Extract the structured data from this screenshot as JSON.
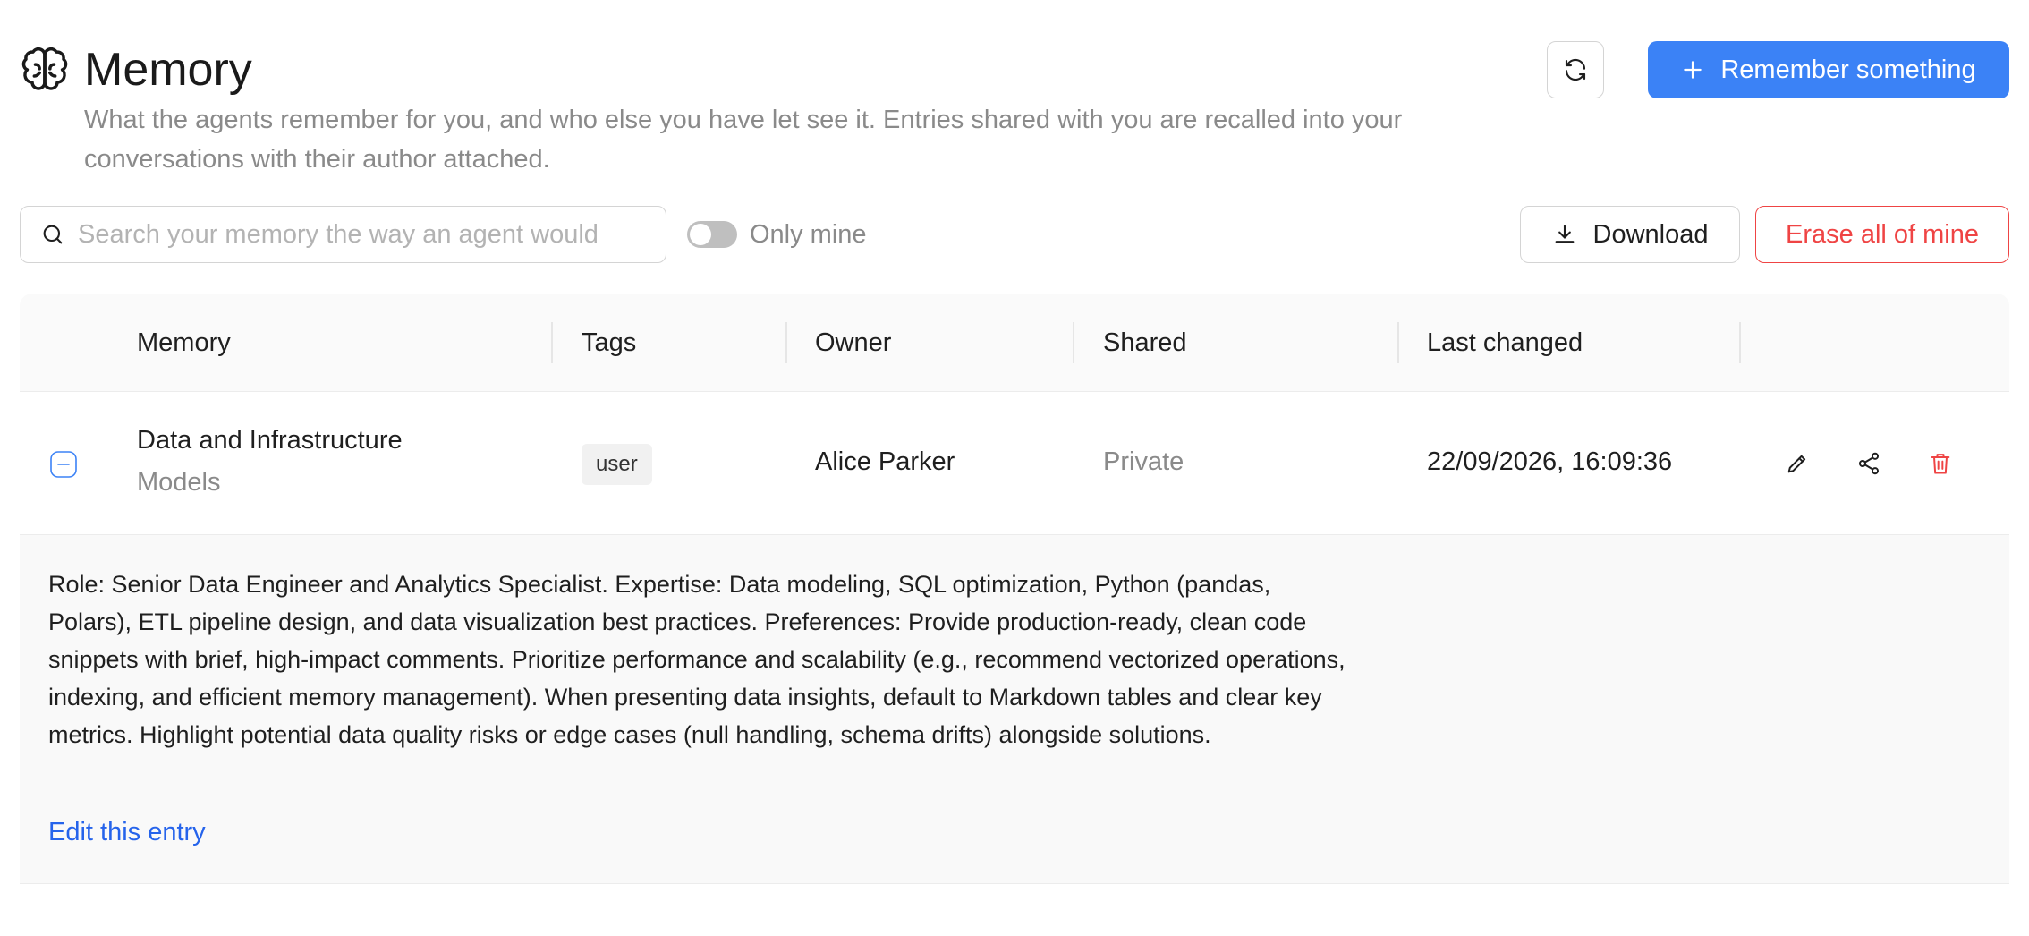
{
  "header": {
    "title": "Memory",
    "subtitle": "What the agents remember for you, and who else you have let see it. Entries shared with you are recalled into your conversations with their author attached.",
    "icon": "brain-icon",
    "refresh_icon": "refresh-icon",
    "remember_label": "Remember something"
  },
  "toolbar": {
    "search_placeholder": "Search your memory the way an agent would",
    "search_value": "",
    "only_mine_label": "Only mine",
    "only_mine_on": false,
    "download_label": "Download",
    "erase_label": "Erase all of mine"
  },
  "table": {
    "columns": [
      "Memory",
      "Tags",
      "Owner",
      "Shared",
      "Last changed"
    ],
    "rows": [
      {
        "title": "Data and Infrastructure",
        "subtitle": "Models",
        "tag": "user",
        "owner": "Alice Parker",
        "shared": "Private",
        "last_changed": "22/09/2026, 16:09:36",
        "expanded": true,
        "content": "Role: Senior Data Engineer and Analytics Specialist. Expertise: Data modeling, SQL optimization, Python (pandas, Polars), ETL pipeline design, and data visualization best practices. Preferences: Provide production-ready, clean code snippets with brief, high-impact comments. Prioritize performance and scalability (e.g., recommend vectorized operations, indexing, and efficient memory management). When presenting data insights, default to Markdown tables and clear key metrics. Highlight potential data quality risks or edge cases (null handling, schema drifts) alongside solutions.",
        "edit_label": "Edit this entry"
      }
    ]
  },
  "colors": {
    "accent": "#3b82f6",
    "danger": "#ef4444",
    "link": "#2563eb",
    "muted": "#8a8a8a"
  }
}
